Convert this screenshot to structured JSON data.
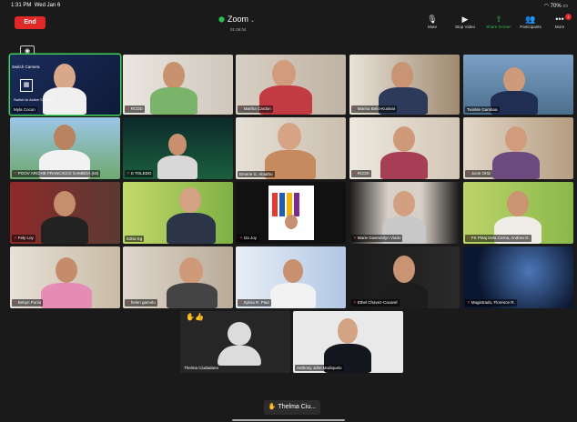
{
  "status": {
    "time": "1:31 PM",
    "date": "Wed Jan 6",
    "battery": "70%"
  },
  "meeting": {
    "end_label": "End",
    "title": "Zoom",
    "timer": "01:06:04"
  },
  "controls": [
    {
      "label": "Mute",
      "icon": "mic-icon"
    },
    {
      "label": "Stop Video",
      "icon": "video-icon"
    },
    {
      "label": "Share Screen",
      "icon": "share-screen-icon"
    },
    {
      "label": "Participants",
      "icon": "participants-icon"
    },
    {
      "label": "More",
      "icon": "more-icon",
      "badge": "1"
    }
  ],
  "self_view": {
    "switch_camera": "Switch Camera",
    "switch_layout": "Switch to Active Speaker"
  },
  "participants": [
    {
      "name": "Myla Cocon"
    },
    {
      "name": "RCDD"
    },
    {
      "name": "Martha Cardon"
    },
    {
      "name": "Marina Bello-Kusivar"
    },
    {
      "name": "Twinkle Gamboa"
    },
    {
      "name": "PGOV ARCHIE FRANCISCO GAMBOA (Ist)"
    },
    {
      "name": "S TOLEDO"
    },
    {
      "name": "Emerie G. Abiatho"
    },
    {
      "name": "RCDD"
    },
    {
      "name": "Jocie Ortiz"
    },
    {
      "name": "Fely Loy"
    },
    {
      "name": "Edna Kg"
    },
    {
      "name": "Iza Joy"
    },
    {
      "name": "Marie Gwendolyn Viado"
    },
    {
      "name": "FS PMaj Dela Cerna, Andrea G."
    },
    {
      "name": "Bebyn Punio"
    },
    {
      "name": "helen gamolo"
    },
    {
      "name": "Sylvia R. Plad"
    },
    {
      "name": "Ethel Chavez-Cacarel"
    },
    {
      "name": "Magistrado, Florence R."
    },
    {
      "name": "Thelma Ciudadano"
    },
    {
      "name": "Anthony John Modiquelo"
    }
  ],
  "tooltip": {
    "text": "Thelma Ciu..."
  }
}
